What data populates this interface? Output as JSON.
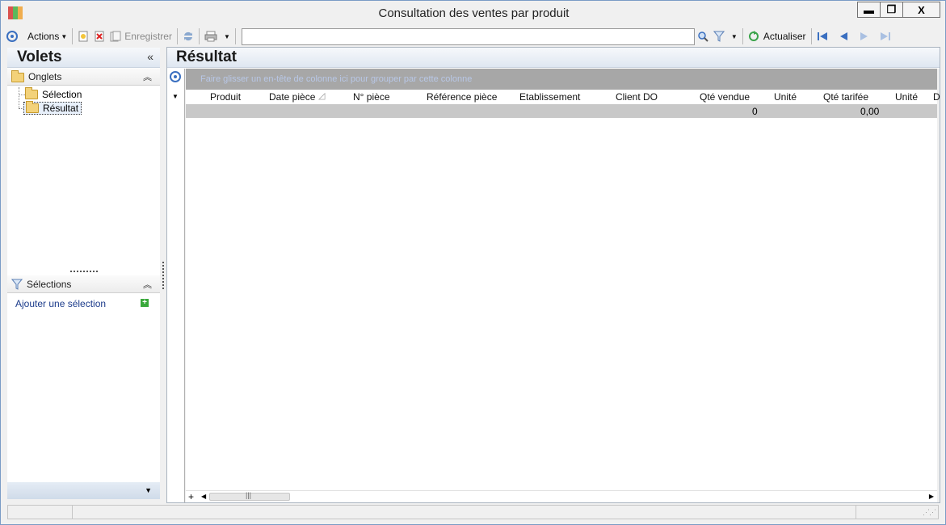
{
  "window": {
    "title": "Consultation des ventes par produit",
    "minimize": "▬",
    "maximize": "❐",
    "close": "X"
  },
  "toolbar": {
    "actions_label": "Actions",
    "save_label": "Enregistrer",
    "refresh_label": "Actualiser",
    "search_value": ""
  },
  "left_panel": {
    "title": "Volets",
    "collapse_glyph": "«",
    "tabs_section": {
      "label": "Onglets",
      "items": [
        {
          "label": "Sélection"
        },
        {
          "label": "Résultat"
        }
      ]
    },
    "selections_section": {
      "label": "Sélections",
      "add_link": "Ajouter une sélection",
      "add_glyph": "+"
    }
  },
  "result": {
    "title": "Résultat",
    "group_hint": "Faire glisser un en-tête de colonne ici pour grouper par cette colonne",
    "columns": [
      {
        "label": "Produit"
      },
      {
        "label": "Date pièce"
      },
      {
        "label": "N° pièce"
      },
      {
        "label": "Référence pièce"
      },
      {
        "label": "Etablissement"
      },
      {
        "label": "Client DO"
      },
      {
        "label": "Qté vendue"
      },
      {
        "label": "Unité"
      },
      {
        "label": "Qté tarifée"
      },
      {
        "label": "Unité"
      },
      {
        "label": "D"
      }
    ],
    "totals": {
      "qte_vendue": "0",
      "qte_tarifee": "0,00"
    },
    "scroll_plus": "+"
  },
  "colors": {
    "accent": "#3a6fc0",
    "group_bar": "#a7a7a7",
    "total_row": "#c8c8c8",
    "link": "#1a3a8a"
  }
}
